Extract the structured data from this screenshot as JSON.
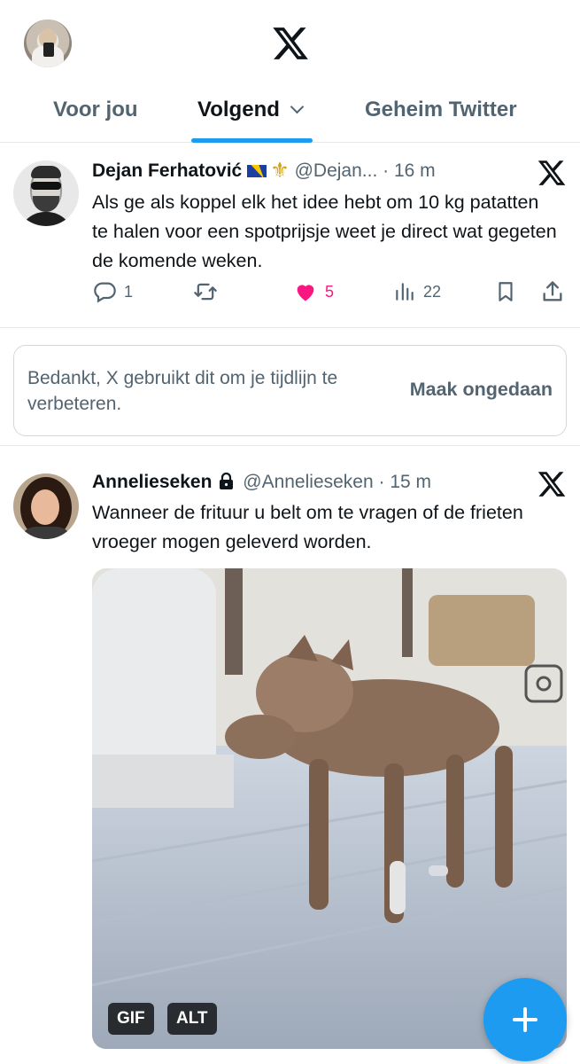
{
  "header": {
    "logo": "x-logo"
  },
  "tabs": [
    {
      "label": "Voor jou",
      "active": false
    },
    {
      "label": "Volgend",
      "active": true
    },
    {
      "label": "Geheim Twitter",
      "active": false
    }
  ],
  "colors": {
    "accent": "#1d9bf0",
    "like": "#f91880",
    "muted": "#536471",
    "text": "#0f1419"
  },
  "tweet1": {
    "name": "Dejan Ferhatović",
    "handle": "@Dejan...",
    "time": "16 m",
    "text": "Als ge als koppel elk het idee hebt om 10 kg patatten te halen voor een spotprijsje weet je direct wat gegeten de komende weken.",
    "replies": "1",
    "likes": "5",
    "views": "22"
  },
  "feedback": {
    "text": "Bedankt, X gebruikt dit om je tijdlijn te verbeteren.",
    "undo": "Maak ongedaan"
  },
  "tweet2": {
    "name": "Annelieseken",
    "handle": "@Annelieseken",
    "time": "15 m",
    "text": "Wanneer de frituur u belt om te vragen of de frieten vroeger mogen geleverd worden.",
    "badges": {
      "gif": "GIF",
      "alt": "ALT"
    }
  },
  "icons": [
    "x-logo",
    "reply-icon",
    "retweet-icon",
    "heart-icon",
    "views-icon",
    "bookmark-icon",
    "share-icon",
    "lock-icon",
    "plus-icon",
    "chevron-down-icon",
    "instagram-icon"
  ]
}
